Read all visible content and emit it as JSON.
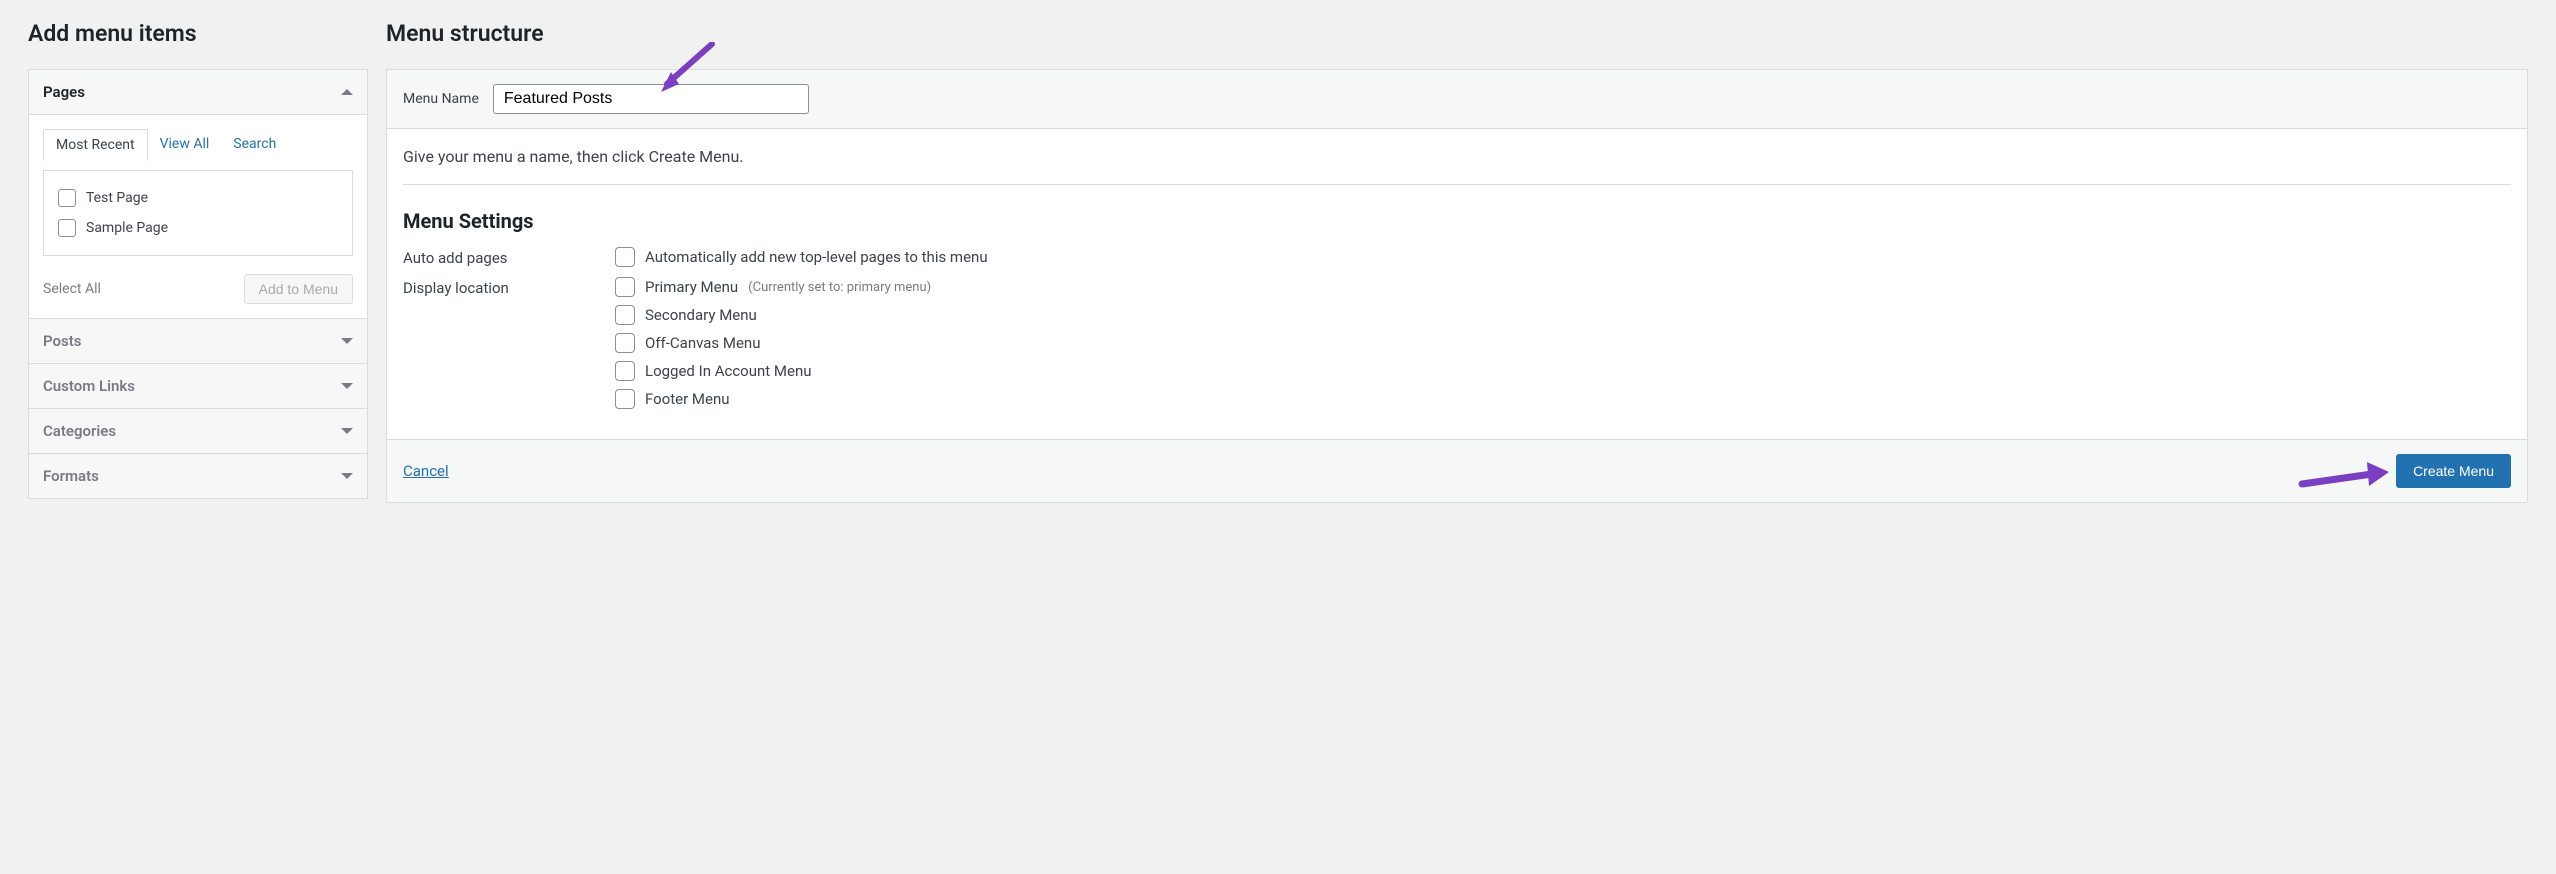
{
  "left": {
    "heading": "Add menu items",
    "pages": {
      "title": "Pages",
      "tabs": {
        "recent": "Most Recent",
        "view_all": "View All",
        "search": "Search"
      },
      "items": [
        "Test Page",
        "Sample Page"
      ],
      "select_all": "Select All",
      "add_button": "Add to Menu"
    },
    "collapsed": [
      "Posts",
      "Custom Links",
      "Categories",
      "Formats"
    ]
  },
  "right": {
    "heading": "Menu structure",
    "menu_name_label": "Menu Name",
    "menu_name_value": "Featured Posts",
    "instructions": "Give your menu a name, then click Create Menu.",
    "settings_title": "Menu Settings",
    "auto_add_label": "Auto add pages",
    "auto_add_option": "Automatically add new top-level pages to this menu",
    "display_label": "Display location",
    "locations": [
      {
        "label": "Primary Menu",
        "note": "(Currently set to: primary menu)"
      },
      {
        "label": "Secondary Menu",
        "note": ""
      },
      {
        "label": "Off-Canvas Menu",
        "note": ""
      },
      {
        "label": "Logged In Account Menu",
        "note": ""
      },
      {
        "label": "Footer Menu",
        "note": ""
      }
    ],
    "cancel": "Cancel",
    "create_button": "Create Menu"
  }
}
